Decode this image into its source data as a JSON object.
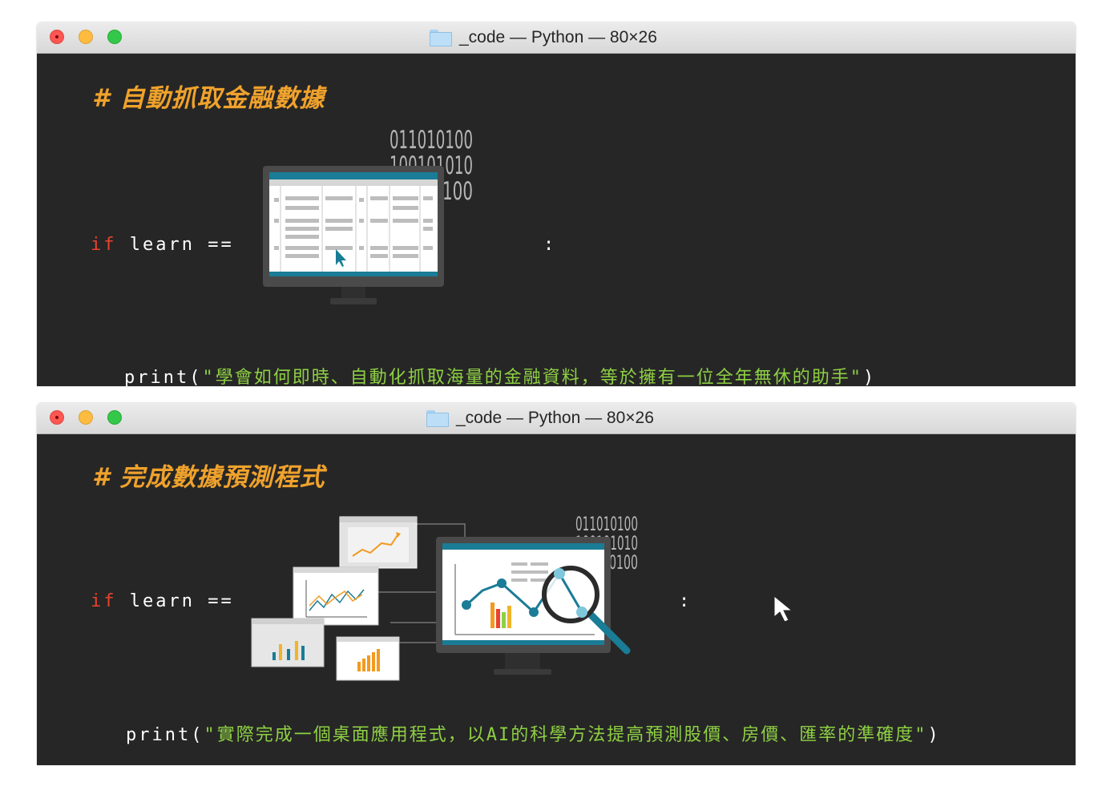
{
  "window1": {
    "title": "_code — Python — 80×26",
    "comment": "# 自動抓取金融數據",
    "code": {
      "keyword": "if",
      "expr": "learn ==",
      "colon": ":",
      "print_fn": "print",
      "paren_open": "(",
      "quote_open": "\"",
      "string": "學會如何即時、自動化抓取海量的金融資料，等於擁有一位全年無休的助手",
      "quote_close": "\"",
      "paren_close": ")"
    },
    "binary": [
      "011010100",
      "100101010",
      "100"
    ]
  },
  "window2": {
    "title": "_code — Python — 80×26",
    "comment": "# 完成數據預測程式",
    "code": {
      "keyword": "if",
      "expr": "learn ==",
      "colon": ":",
      "print_fn": "print",
      "paren_open": "(",
      "quote_open": "\"",
      "string": "實際完成一個桌面應用程式，以AI的科學方法提高預測股價、房價、匯率的準確度",
      "quote_close": "\"",
      "paren_close": ")"
    },
    "binary": [
      "011010100",
      "100101010",
      "0100"
    ]
  },
  "colors": {
    "terminal_bg": "#262626",
    "comment": "#f0a22c",
    "keyword": "#e8432c",
    "string": "#8ed043",
    "accent_teal": "#1a7c96"
  },
  "icons": [
    "folder-icon",
    "monitor-table-icon",
    "pointer-icon",
    "analytics-dashboard-icon",
    "magnifier-icon",
    "mouse-cursor-icon"
  ]
}
